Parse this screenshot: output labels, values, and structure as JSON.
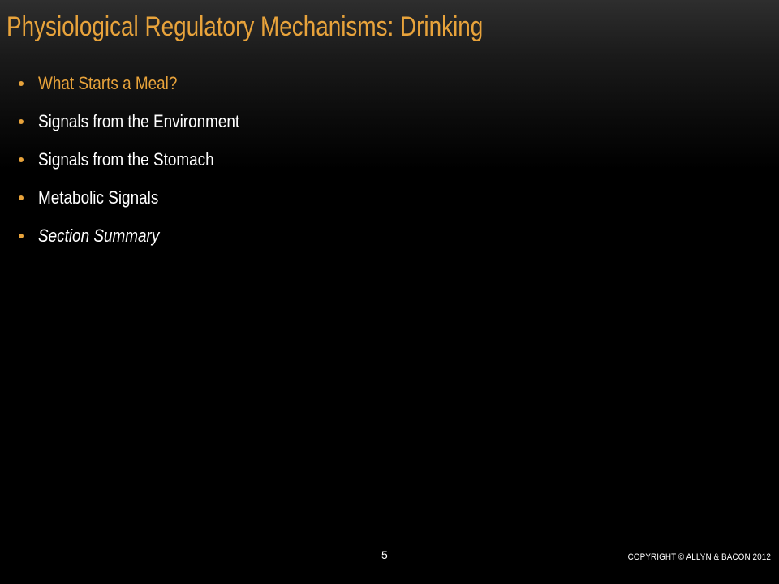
{
  "slide": {
    "title": "Physiological Regulatory Mechanisms: Drinking",
    "bullets": [
      "What Starts a Meal?",
      "Signals from the Environment",
      "Signals from the Stomach",
      "Metabolic Signals",
      "Section Summary"
    ],
    "page_number": "5",
    "copyright": "COPYRIGHT © ALLYN & BACON 2012"
  },
  "colors": {
    "accent": "#e8a33b",
    "text": "#ffffff",
    "background": "#000000"
  }
}
